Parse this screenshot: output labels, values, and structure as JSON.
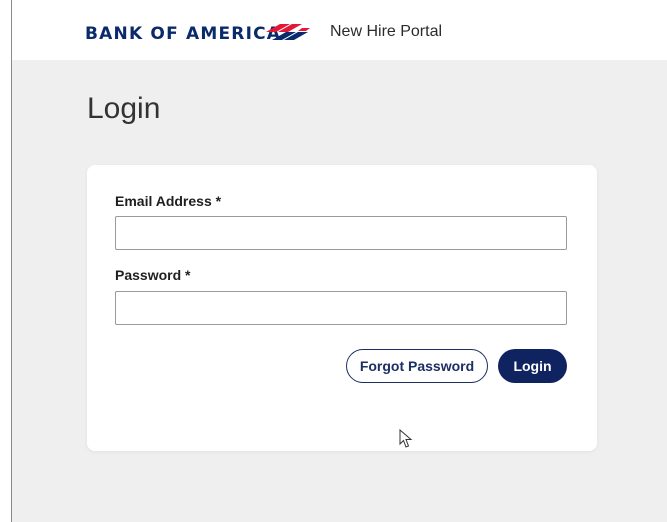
{
  "header": {
    "brand": "BANK OF AMERICA",
    "portal_title": "New Hire Portal",
    "logo_icon": "bank-of-america-flag-icon"
  },
  "page": {
    "title": "Login"
  },
  "form": {
    "email_label": "Email Address *",
    "email_value": "",
    "email_placeholder": "",
    "password_label": "Password *",
    "password_value": "",
    "password_placeholder": "",
    "forgot_label": "Forgot Password",
    "login_label": "Login"
  },
  "colors": {
    "brand_navy": "#0a2a6b",
    "brand_red": "#e31837",
    "button_navy": "#0f2360",
    "background": "#efefef"
  }
}
